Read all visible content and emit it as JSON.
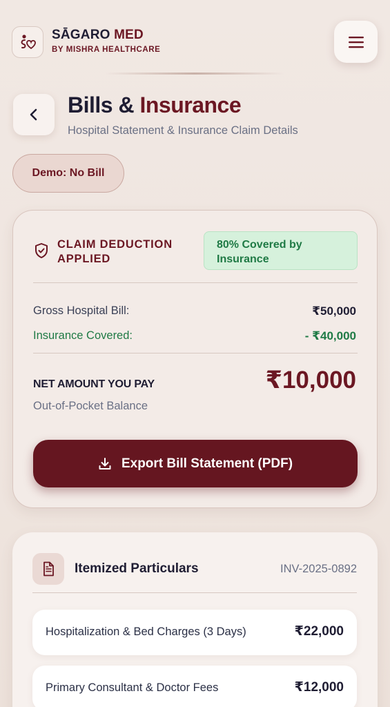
{
  "header": {
    "brand_main": "SĀGARO",
    "brand_accent": "MED",
    "brand_sub": "BY MISHRA HEALTHCARE",
    "logo_icon": "heart-logo-icon",
    "menu_icon": "hamburger-icon"
  },
  "page": {
    "title_main": "Bills & ",
    "title_accent": "Insurance",
    "subtitle": "Hospital Statement & Insurance Claim Details",
    "back_icon": "chevron-left-icon",
    "demo_label": "Demo: No Bill"
  },
  "claim": {
    "title": "CLAIM DEDUCTION APPLIED",
    "badge": "80% Covered by Insurance",
    "gross_label": "Gross Hospital Bill:",
    "gross_value": "₹50,000",
    "insurance_label": "Insurance Covered:",
    "insurance_value": "- ₹40,000",
    "net_label": "NET AMOUNT YOU PAY",
    "net_value": "₹10,000",
    "oop_label": "Out-of-Pocket Balance",
    "export_label": "Export Bill Statement (PDF)"
  },
  "items": {
    "title": "Itemized Particulars",
    "invoice": "INV-2025-0892",
    "rows": [
      {
        "name": "Hospitalization & Bed Charges (3 Days)",
        "amount": "₹22,000"
      },
      {
        "name": "Primary Consultant & Doctor Fees",
        "amount": "₹12,000"
      }
    ]
  },
  "colors": {
    "brand": "#6b1723",
    "navy": "#1f1d33",
    "green": "#1f7a45",
    "badge_bg": "#d6f1dc"
  }
}
